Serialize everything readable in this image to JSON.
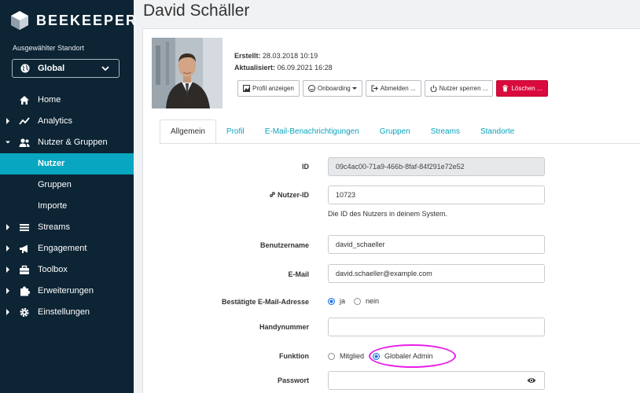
{
  "app": {
    "brand": "BEEKEEPER"
  },
  "sidebar": {
    "location_label": "Ausgewählter Standort",
    "location_value": "Global",
    "items": [
      {
        "label": "Home",
        "icon": "home-icon"
      },
      {
        "label": "Analytics",
        "icon": "analytics-icon"
      },
      {
        "label": "Nutzer & Gruppen",
        "icon": "users-icon"
      },
      {
        "label": "Nutzer"
      },
      {
        "label": "Gruppen"
      },
      {
        "label": "Importe"
      },
      {
        "label": "Streams",
        "icon": "streams-icon"
      },
      {
        "label": "Engagement",
        "icon": "megaphone-icon"
      },
      {
        "label": "Toolbox",
        "icon": "toolbox-icon"
      },
      {
        "label": "Erweiterungen",
        "icon": "puzzle-icon"
      },
      {
        "label": "Einstellungen",
        "icon": "gear-icon"
      }
    ]
  },
  "user": {
    "name": "David Schäller",
    "created_label": "Erstellt:",
    "created_value": "28.03.2018 10:19",
    "updated_label": "Aktualisiert:",
    "updated_value": "06.09.2021 16:28"
  },
  "actions": {
    "view_profile": "Profil anzeigen",
    "onboarding": "Onboarding",
    "logout": "Abmelden ...",
    "block": "Nutzer sperren ...",
    "delete": "Löschen ..."
  },
  "tabs": [
    "Allgemein",
    "Profil",
    "E-Mail-Benachrichtigungen",
    "Gruppen",
    "Streams",
    "Standorte"
  ],
  "form": {
    "id_label": "ID",
    "id_value": "09c4ac00-71a9-466b-8faf-84f291e72e52",
    "user_id_label": "Nutzer-ID",
    "user_id_value": "10723",
    "user_id_help": "Die ID des Nutzers in deinem System.",
    "username_label": "Benutzername",
    "username_value": "david_schaeller",
    "email_label": "E-Mail",
    "email_value": "david.schaeller@example.com",
    "verified_label": "Bestätigte E-Mail-Adresse",
    "verified_yes": "ja",
    "verified_no": "nein",
    "mobile_label": "Handynummer",
    "mobile_value": "",
    "role_label": "Funktion",
    "role_member": "Mitglied",
    "role_admin": "Globaler Admin",
    "password_label": "Passwort",
    "password_value": ""
  },
  "colors": {
    "sidebar_bg": "#0c2434",
    "accent": "#08a6c0",
    "danger": "#d90a3d",
    "highlight": "#e81de6",
    "radio_selected": "#1a6fe0"
  }
}
